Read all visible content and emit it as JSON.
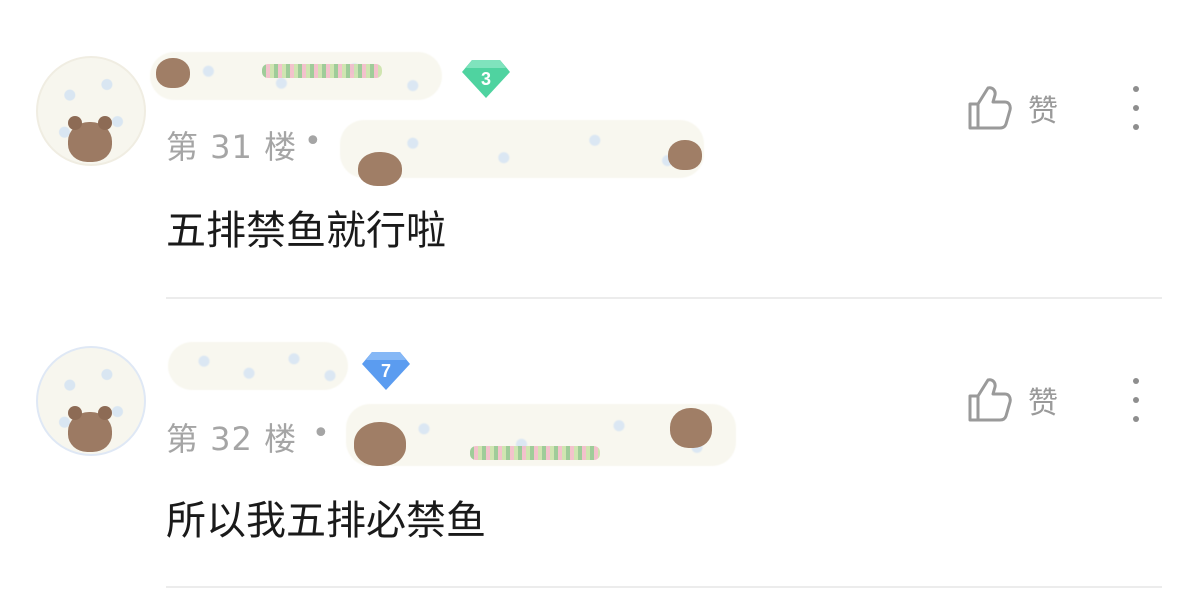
{
  "comments": [
    {
      "badge": "3",
      "badge_color": "#4fd3a0",
      "floor": "第 31 楼",
      "separator": "•",
      "text": "五排禁鱼就行啦",
      "like_label": "赞",
      "like_icon": "thumbs-up-icon",
      "more_icon": "more-vertical-icon"
    },
    {
      "badge": "7",
      "badge_color": "#5b9cf0",
      "floor": "第 32 楼",
      "separator": "•",
      "text": "所以我五排必禁鱼",
      "like_label": "赞",
      "like_icon": "thumbs-up-icon",
      "more_icon": "more-vertical-icon"
    }
  ]
}
